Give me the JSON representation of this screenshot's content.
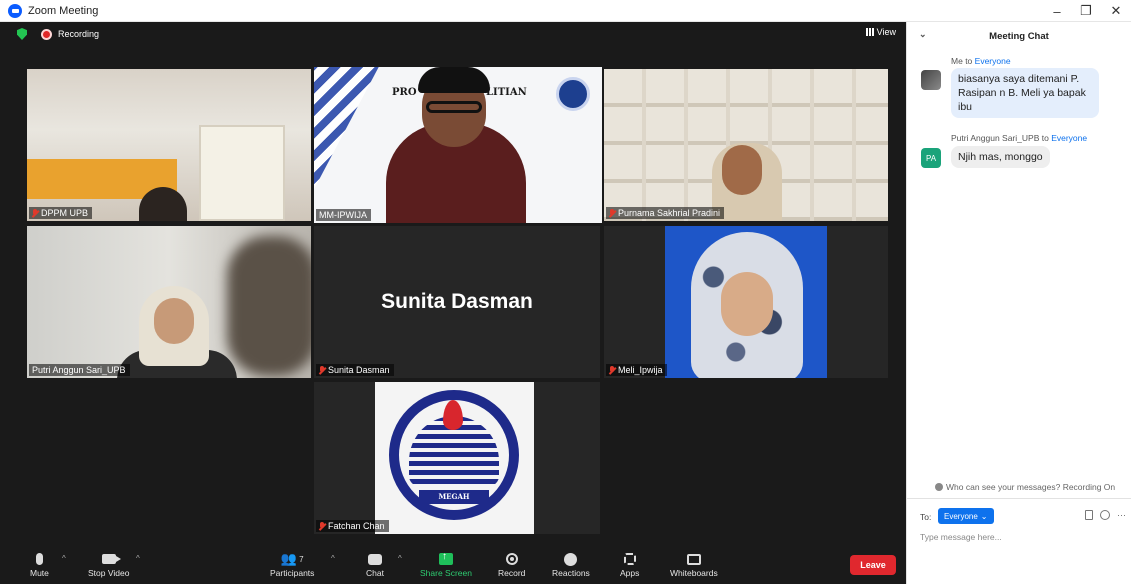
{
  "window": {
    "title": "Zoom Meeting"
  },
  "status": {
    "recording_label": "Recording",
    "view_label": "View"
  },
  "tiles": [
    {
      "name": "DPPM UPB"
    },
    {
      "name": "MM-IPWIJA",
      "slide_text_left": "PRO",
      "slide_text_right": "LITIAN"
    },
    {
      "name": "Purnama Sakhrial Pradini"
    },
    {
      "name": "Putri Anggun Sari_UPB"
    },
    {
      "name": "Sunita Dasman",
      "display_name": "Sunita Dasman"
    },
    {
      "name": "Meli_Ipwija"
    },
    {
      "name": "Fatchan Chan",
      "logo_text": "MEGAH"
    }
  ],
  "toolbar": {
    "mute": "Mute",
    "stop_video": "Stop Video",
    "participants": "Participants",
    "participants_count": "7",
    "chat": "Chat",
    "share_screen": "Share Screen",
    "record": "Record",
    "reactions": "Reactions",
    "apps": "Apps",
    "whiteboards": "Whiteboards",
    "leave": "Leave"
  },
  "chat": {
    "title": "Meeting Chat",
    "messages": [
      {
        "sender": "Me",
        "to_word": "to",
        "recipient": "Everyone",
        "text": "biasanya saya ditemani P. Rasipan n B. Meli ya bapak ibu"
      },
      {
        "sender": "Putri Anggun Sari_UPB",
        "to_word": "to",
        "recipient": "Everyone",
        "avatar_initials": "PA",
        "text": "Njih mas, monggo"
      }
    ],
    "notice": "Who can see your messages? Recording On",
    "to_label": "To:",
    "to_value": "Everyone",
    "input_placeholder": "Type message here..."
  },
  "colors": {
    "accent": "#0e72ed",
    "leave": "#e0282e",
    "active_speaker": "#c9e843",
    "share_green": "#1fbf5a"
  },
  "icons": [
    "zoom-logo-icon",
    "shield-icon",
    "record-dot-icon",
    "grid-view-icon",
    "muted-mic-icon",
    "mic-icon",
    "camera-icon",
    "participants-icon",
    "chat-icon",
    "share-screen-icon",
    "record-icon",
    "reactions-icon",
    "apps-icon",
    "whiteboard-icon",
    "chevron-down-icon",
    "file-icon",
    "emoji-icon",
    "more-icon",
    "minimize-icon",
    "maximize-icon",
    "close-icon"
  ]
}
